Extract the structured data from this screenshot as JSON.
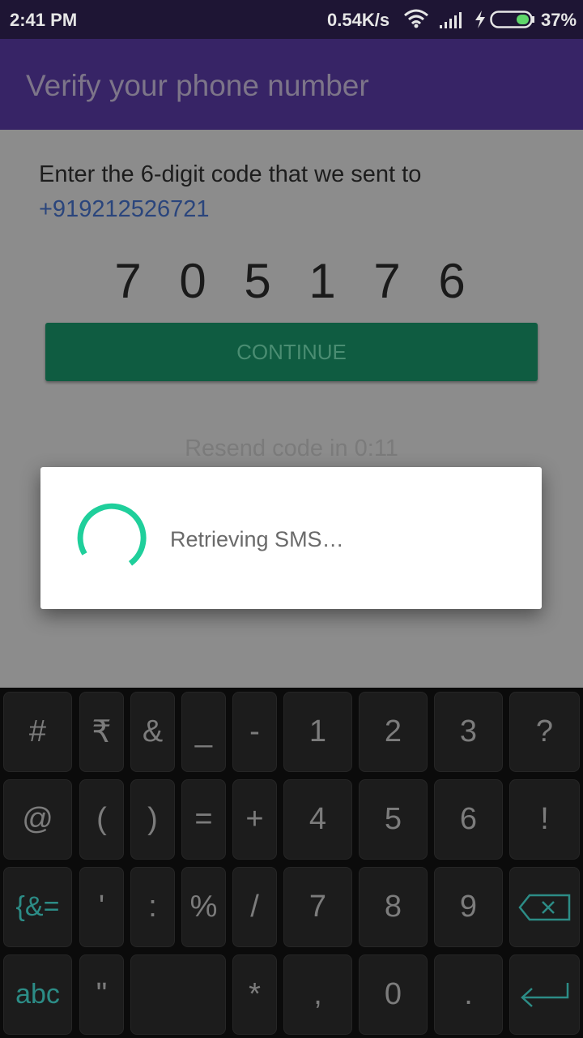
{
  "status_bar": {
    "time": "2:41 PM",
    "network_speed": "0.54K/s",
    "battery": "37%",
    "icons": [
      "wifi-icon",
      "signal-icon",
      "charging-icon",
      "battery-icon"
    ]
  },
  "app_bar": {
    "title": "Verify your phone number"
  },
  "verification": {
    "instruction": "Enter the 6-digit code that we sent to",
    "phone_number": "+919212526721",
    "digits": [
      "7",
      "0",
      "5",
      "1",
      "7",
      "6"
    ],
    "continue_label": "CONTINUE",
    "resend_text": "Resend code in 0:11"
  },
  "dialog": {
    "message": "Retrieving SMS…",
    "spinner_color": "#1fcf9b"
  },
  "keyboard": {
    "rows": [
      [
        "#",
        "₹",
        "&",
        "_",
        "-",
        "1",
        "2",
        "3",
        "?"
      ],
      [
        "@",
        "(",
        ")",
        "=",
        "+",
        "4",
        "5",
        "6",
        "!"
      ],
      [
        "{&=",
        "'",
        ":",
        "%",
        "/",
        "7",
        "8",
        "9",
        "backspace"
      ],
      [
        "abc",
        "\"",
        "space",
        "*",
        ",",
        "0",
        ".",
        "enter"
      ]
    ]
  },
  "colors": {
    "app_bar": "#372466",
    "accent_teal": "#2c8c86",
    "button": "#0f5c41"
  }
}
